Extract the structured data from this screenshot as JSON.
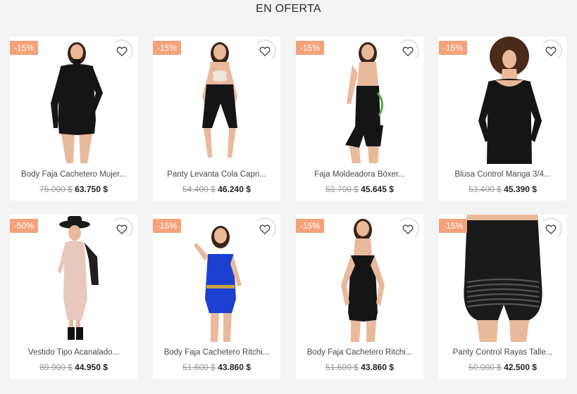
{
  "section": {
    "title": "EN OFERTA"
  },
  "products": [
    {
      "badge": "-15%",
      "name": "Body Faja Cachetero Mujer...",
      "old_price": "75.000 $",
      "new_price": "63.750 $",
      "garment": "longsleeve-body",
      "garment_color": "#151515"
    },
    {
      "badge": "-15%",
      "name": "Panty Levanta Cola Capri...",
      "old_price": "54.400 $",
      "new_price": "46.240 $",
      "garment": "capri",
      "garment_color": "#151515"
    },
    {
      "badge": "-15%",
      "name": "Faja Moldeadora Bóxer...",
      "old_price": "53.700 $",
      "new_price": "45.645 $",
      "garment": "boxer",
      "garment_color": "#151515"
    },
    {
      "badge": "-15%",
      "name": "Blusa Control Manga 3/4...",
      "old_price": "53.400 $",
      "new_price": "45.390 $",
      "garment": "blouse",
      "garment_color": "#151515"
    },
    {
      "badge": "-50%",
      "name": "Vestido Tipo Acanalado...",
      "old_price": "89.900 $",
      "new_price": "44.950 $",
      "garment": "dress",
      "garment_color": "#e8c8bd"
    },
    {
      "badge": "-15%",
      "name": "Body Faja Cachetero Ritchi...",
      "old_price": "51.600 $",
      "new_price": "43.860 $",
      "garment": "blue-body",
      "garment_color": "#1d3fcf"
    },
    {
      "badge": "-15%",
      "name": "Body Faja Cachetero Ritchi...",
      "old_price": "51.600 $",
      "new_price": "43.860 $",
      "garment": "strap-body",
      "garment_color": "#151515"
    },
    {
      "badge": "-15%",
      "name": "Panty Control Rayas Talle...",
      "old_price": "50.000 $",
      "new_price": "42.500 $",
      "garment": "striped-panty",
      "garment_color": "#1a1a1a"
    }
  ]
}
